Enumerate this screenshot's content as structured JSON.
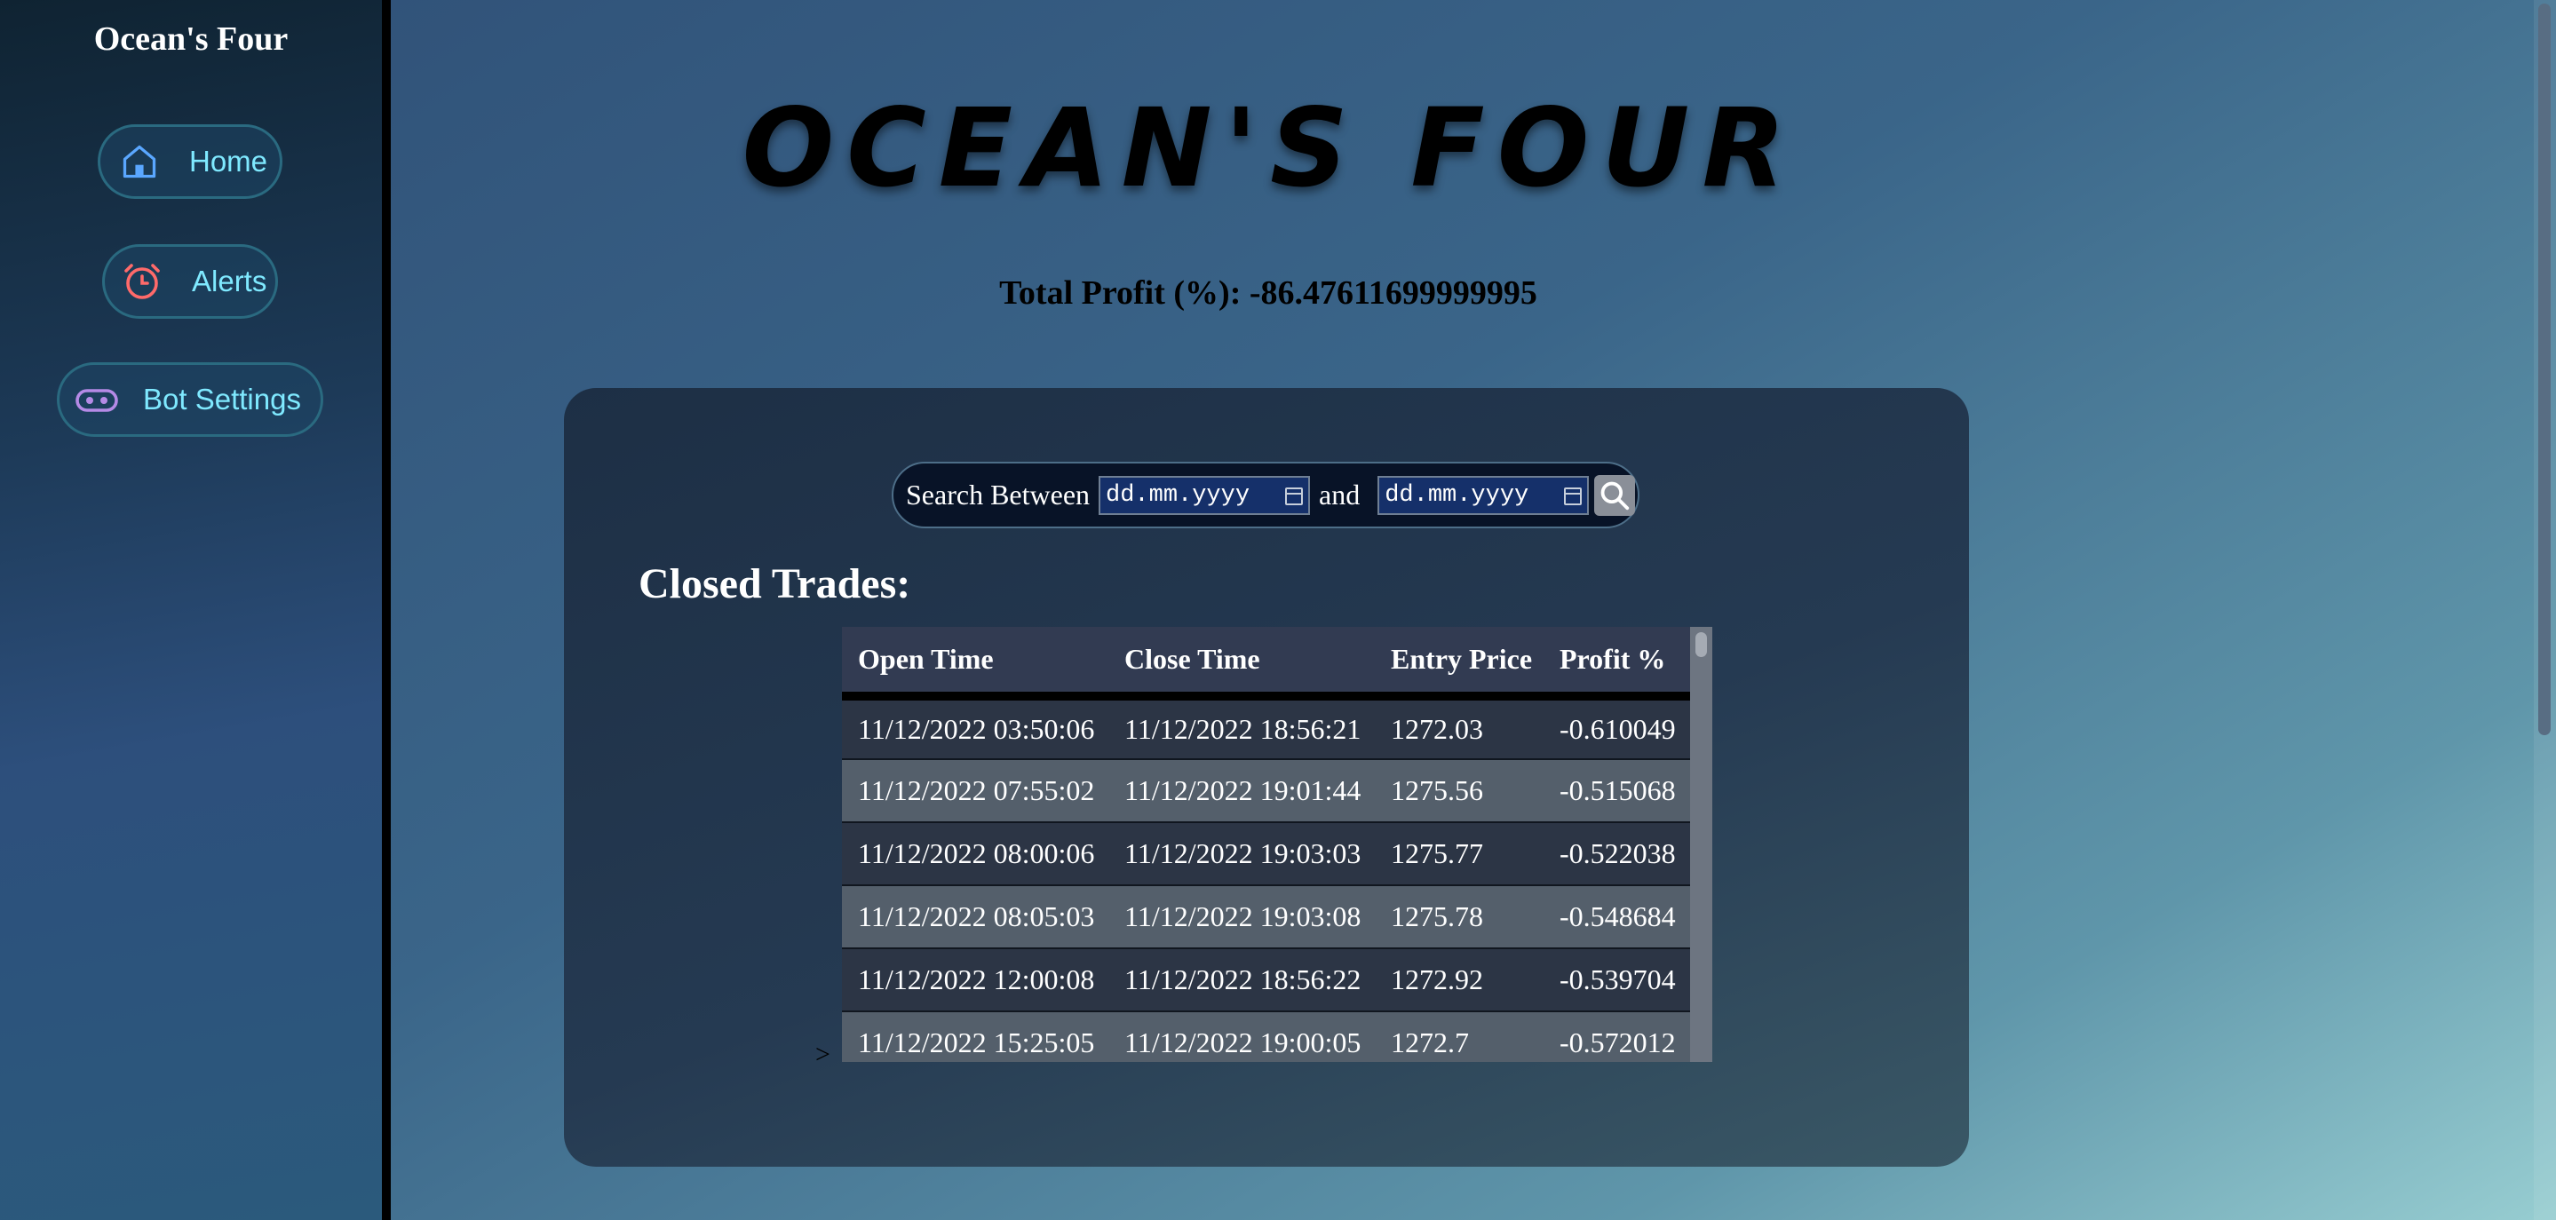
{
  "sidebar": {
    "title": "Ocean's Four",
    "items": [
      {
        "label": "Home",
        "icon": "home-icon",
        "color": "#5aa7ff"
      },
      {
        "label": "Alerts",
        "icon": "alarm-clock-icon",
        "color": "#ff6a6a"
      },
      {
        "label": "Bot Settings",
        "icon": "robot-icon",
        "color": "#b58ae6"
      }
    ]
  },
  "header": {
    "brand": "OCEAN'S FOUR",
    "total_profit": "Total Profit (%): -86.47611699999995"
  },
  "search": {
    "label": "Search Between",
    "from_placeholder": "dd.mm.yyyy",
    "and_label": "and",
    "to_placeholder": "dd.mm.yyyy",
    "button_icon": "magnifier-icon"
  },
  "closed_trades": {
    "title": "Closed Trades:",
    "columns": [
      "Open Time",
      "Close Time",
      "Entry Price",
      "Profit %"
    ],
    "rows": [
      [
        "11/12/2022 03:50:06",
        "11/12/2022 18:56:21",
        "1272.03",
        "-0.610049"
      ],
      [
        "11/12/2022 07:55:02",
        "11/12/2022 19:01:44",
        "1275.56",
        "-0.515068"
      ],
      [
        "11/12/2022 08:00:06",
        "11/12/2022 19:03:03",
        "1275.77",
        "-0.522038"
      ],
      [
        "11/12/2022 08:05:03",
        "11/12/2022 19:03:08",
        "1275.78",
        "-0.548684"
      ],
      [
        "11/12/2022 12:00:08",
        "11/12/2022 18:56:22",
        "1272.92",
        "-0.539704"
      ],
      [
        "11/12/2022 15:25:05",
        "11/12/2022 19:00:05",
        "1272.7",
        "-0.572012"
      ]
    ],
    "stray_marker": ">"
  },
  "colors": {
    "nav_text": "#7fe9ff",
    "nav_border": "#2a6a80",
    "search_bg": "#081327",
    "date_input_bg": "#15306a"
  }
}
